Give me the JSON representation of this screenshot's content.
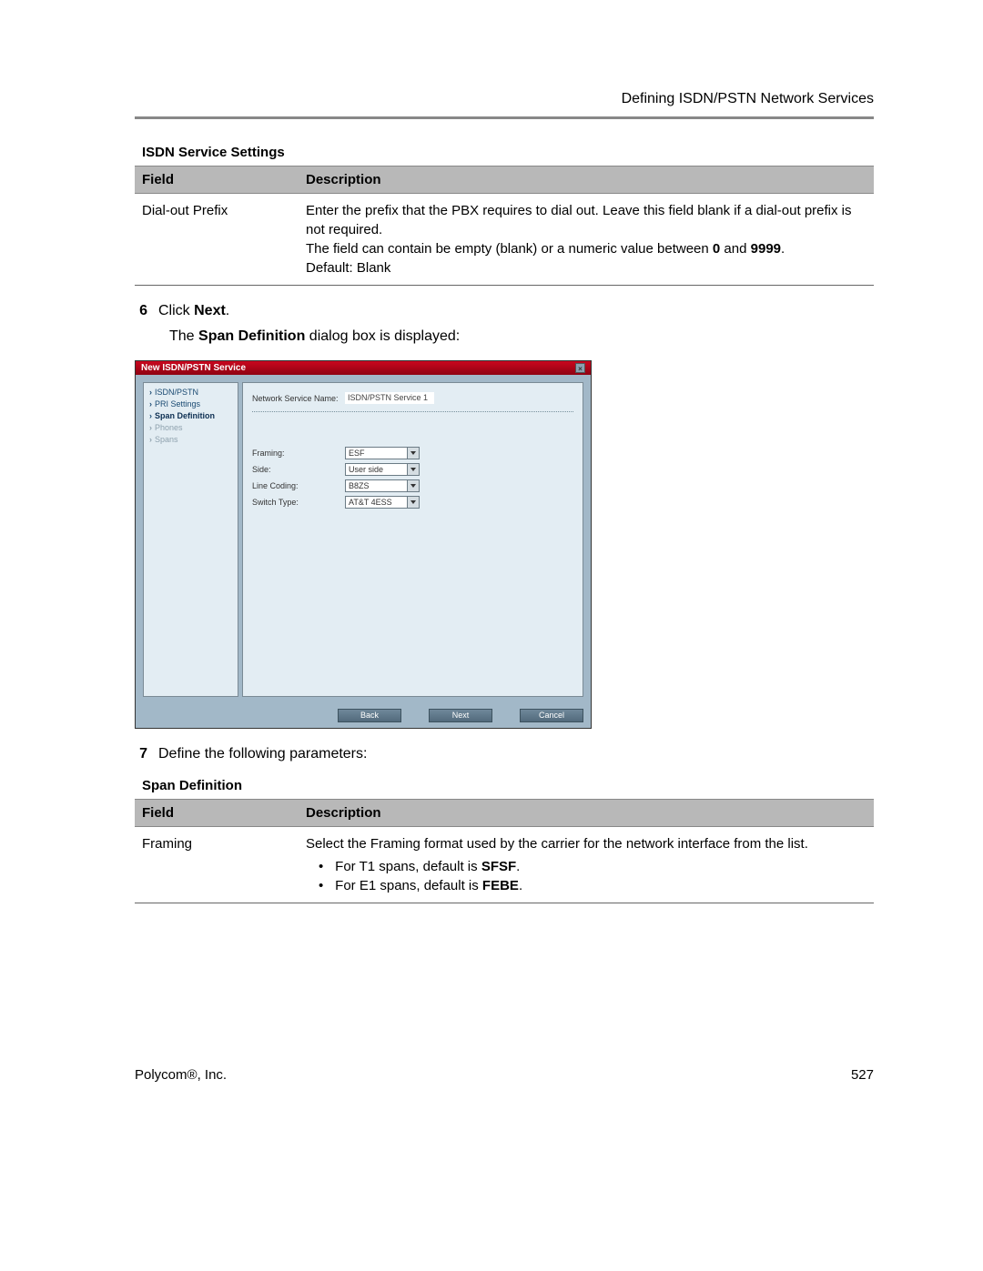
{
  "header": {
    "section": "Defining ISDN/PSTN Network Services"
  },
  "tables": {
    "isdn": {
      "title": "ISDN Service Settings",
      "headers": {
        "field": "Field",
        "desc": "Description"
      },
      "rows": [
        {
          "field": "Dial-out Prefix",
          "desc_line1": "Enter the prefix that the PBX requires to dial out. Leave this field blank if a dial-out prefix is not required.",
          "desc_line2_pre": "The field can contain be empty (blank) or a numeric value between ",
          "desc_line2_b1": "0",
          "desc_line2_mid": " and ",
          "desc_line2_b2": "9999",
          "desc_line2_post": ".",
          "desc_line3": "Default: Blank"
        }
      ]
    },
    "span": {
      "title": "Span Definition",
      "headers": {
        "field": "Field",
        "desc": "Description"
      },
      "rows": [
        {
          "field": "Framing",
          "desc_intro": "Select the Framing format used by the carrier for the network interface from the list.",
          "bullets": [
            {
              "pre": "For T1 spans, default is ",
              "b": "SFSF",
              "post": "."
            },
            {
              "pre": "For E1 spans, default is ",
              "b": "FEBE",
              "post": "."
            }
          ]
        }
      ]
    }
  },
  "steps": {
    "s6": {
      "num": "6",
      "text_pre": "Click ",
      "text_b": "Next",
      "text_post": ".",
      "sub_pre": "The ",
      "sub_b": "Span Definition",
      "sub_post": " dialog box is displayed:"
    },
    "s7": {
      "num": "7",
      "text": "Define the following parameters:"
    }
  },
  "dialog": {
    "title": "New ISDN/PSTN Service",
    "side_items": [
      {
        "label": "ISDN/PSTN",
        "state": "normal"
      },
      {
        "label": "PRI Settings",
        "state": "normal"
      },
      {
        "label": "Span Definition",
        "state": "active"
      },
      {
        "label": "Phones",
        "state": "disabled"
      },
      {
        "label": "Spans",
        "state": "disabled"
      }
    ],
    "form": {
      "service_name_label": "Network Service Name:",
      "service_name_value": "ISDN/PSTN Service 1",
      "rows": [
        {
          "label": "Framing:",
          "value": "ESF"
        },
        {
          "label": "Side:",
          "value": "User side"
        },
        {
          "label": "Line Coding:",
          "value": "B8ZS"
        },
        {
          "label": "Switch Type:",
          "value": "AT&T 4ESS"
        }
      ]
    },
    "buttons": {
      "back": "Back",
      "next": "Next",
      "cancel": "Cancel"
    }
  },
  "footer": {
    "left": "Polycom®, Inc.",
    "right": "527"
  }
}
